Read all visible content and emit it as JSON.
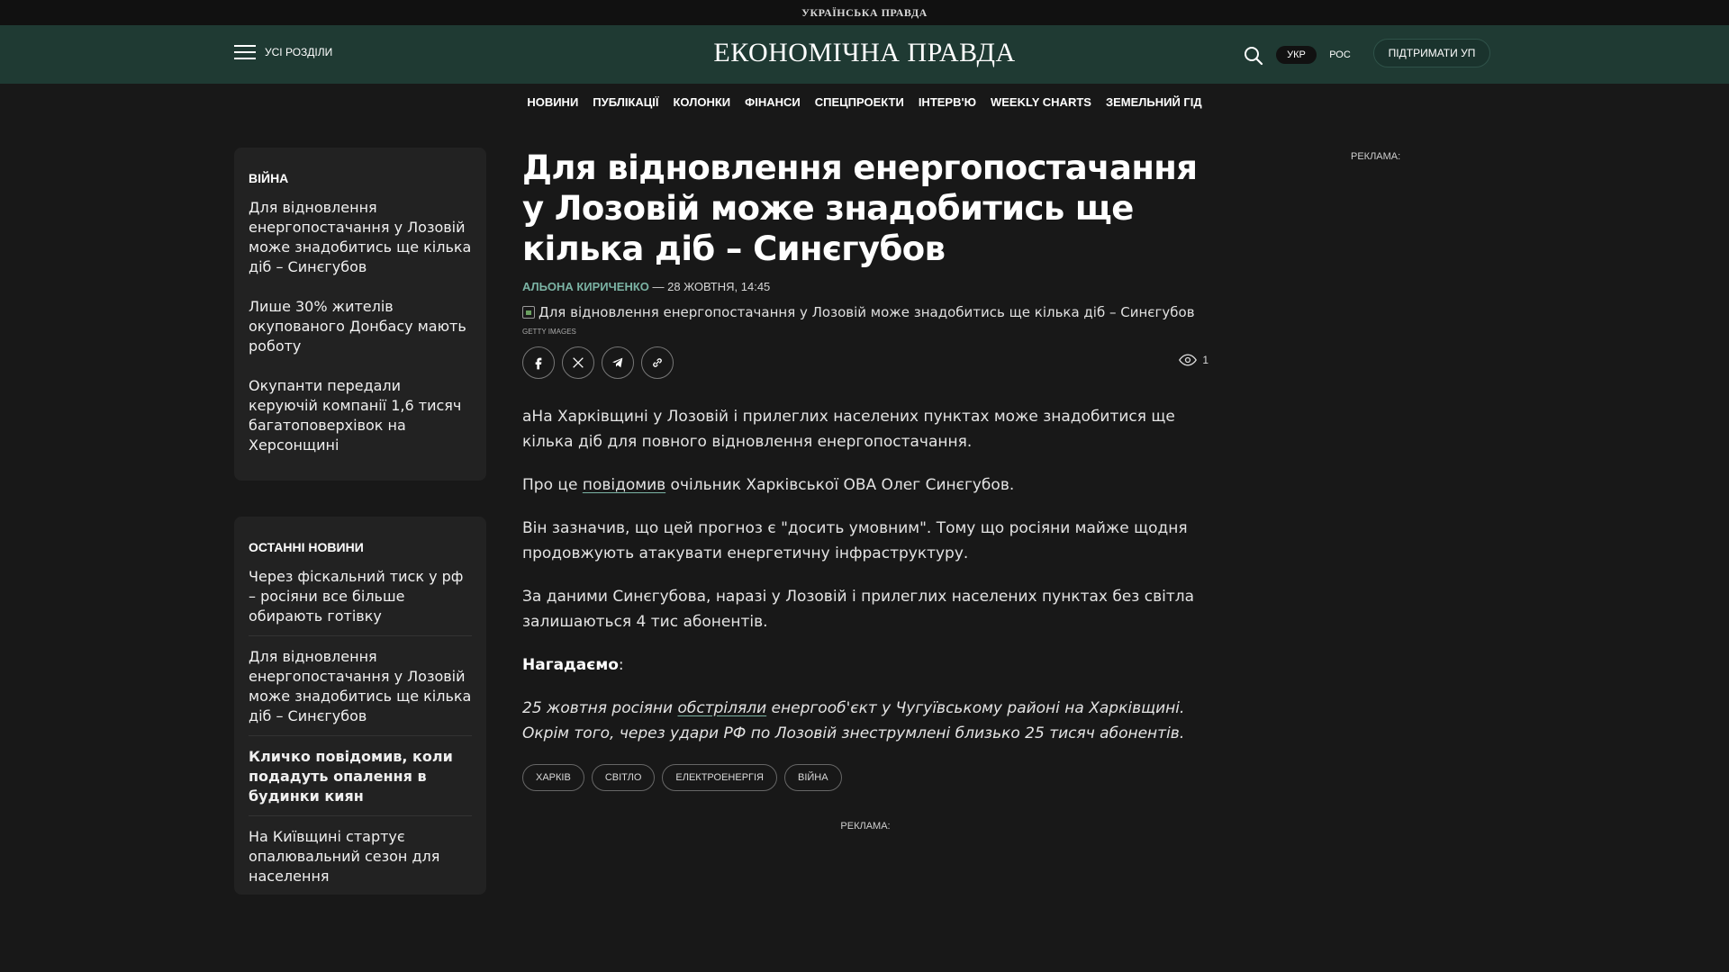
{
  "topbar": {
    "brand": "УКРАЇНСЬКА ПРАВДА"
  },
  "header": {
    "menu_label": "УСІ РОЗДІЛИ",
    "logo": "ЕКОНОМІЧНА ПРАВДА",
    "lang_ukr": "УКР",
    "lang_ros": "РОС",
    "support_label": "ПІДТРИМАТИ УП",
    "accent_color": "#1f3a33"
  },
  "nav": {
    "items": [
      "НОВИНИ",
      "ПУБЛІКАЦІЇ",
      "КОЛОНКИ",
      "ФІНАНСИ",
      "СПЕЦПРОЕКТИ",
      "ІНТЕРВ'Ю",
      "WEEKLY CHARTS",
      "ЗЕМЕЛЬНИЙ ГІД"
    ]
  },
  "sidebar_war": {
    "title": "ВІЙНА",
    "items": [
      "Для відновлення енергопостачання у Лозовій може знадобитись ще кілька діб – Синєгубов",
      "Лише 30% жителів окупованого Донбасу мають роботу",
      "Окупанти передали керуючій компанії 1,6 тисяч багатоповерхівок на Херсонщині"
    ]
  },
  "sidebar_latest": {
    "title": "ОСТАННІ НОВИНИ",
    "items": [
      "Через фіскальний тиск у рф – росіяни все більше обирають готівку",
      "Для відновлення енергопостачання у Лозовій може знадобитись ще кілька діб – Синєгубов",
      "Кличко повідомив, коли подадуть опалення в будинки киян",
      "На Київщині стартує опалювальний сезон для населення"
    ]
  },
  "article": {
    "headline": "Для відновлення енергопостачання у Лозовій може знадобитись ще кілька діб – Синєгубов",
    "author": "АЛЬОНА КИРИЧЕНКО",
    "date": " — 28 ЖОВТНЯ, 14:45",
    "image_alt": "Для відновлення енергопостачання у Лозовій може знадобитись ще кілька діб – Синєгубов",
    "image_credit": "GETTY IMAGES",
    "views": "1",
    "p1": "аНа Харківщині у Лозовій і прилеглих населених пунктах може знадобитися ще кілька діб для повного відновлення енергопостачання.",
    "p2_before": "Про це ",
    "p2_link": "повідомив",
    "p2_after": " очільник Харківської ОВА Олег Синєгубов.",
    "p3": "Він зазначив, що цей прогноз є \"досить умовним\". Тому що росіяни майже щодня продовжують атакувати енергетичну інфраструктуру.",
    "p4": "За даними Синєгубова, наразі у Лозовій і прилеглих населених пунктах без світла залишаються 4 тис абонентів.",
    "p5_bold": "Нагадаємо",
    "p5_after": ":",
    "p6_before": "25 жовтня росіяни ",
    "p6_link": "обстріляли",
    "p6_after": " енергооб'єкт у Чугуївському районі на Харківщині. Окрім того, через удари РФ по Лозовій знеструмлені близько 25 тисяч абонентів.",
    "tags": [
      "ХАРКІВ",
      "СВІТЛО",
      "ЕЛЕКТРОЕНЕРГІЯ",
      "ВІЙНА"
    ]
  },
  "ads": {
    "label_right": "РЕКЛАМА:",
    "label_bottom": "РЕКЛАМА:"
  }
}
